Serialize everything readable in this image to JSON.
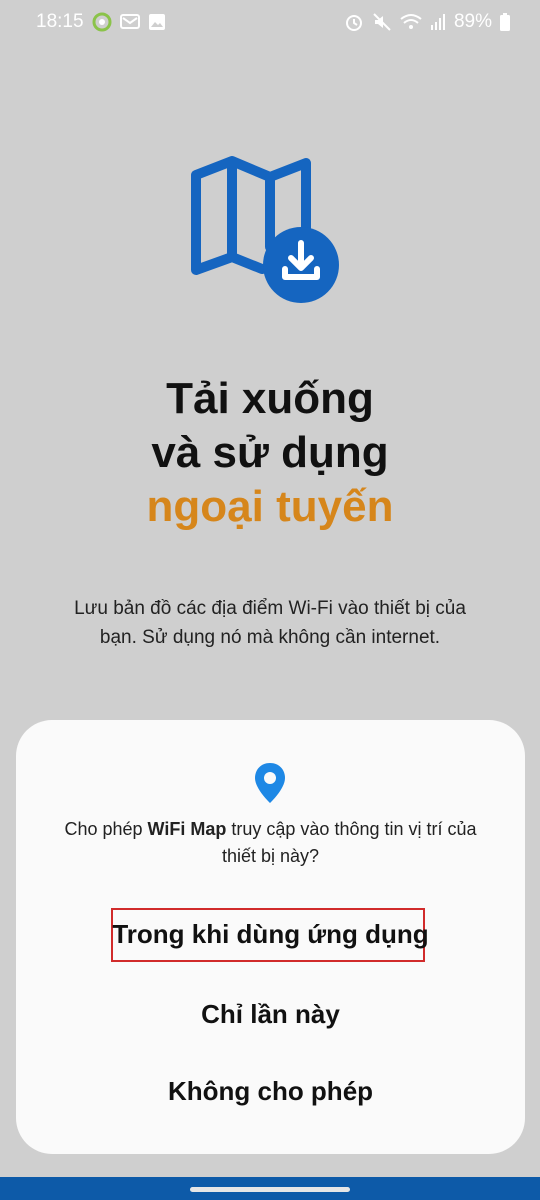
{
  "status_bar": {
    "time": "18:15",
    "battery": "89%",
    "left_icons": [
      "app-notification-icon",
      "messages-icon",
      "gallery-icon"
    ],
    "right_icons": [
      "alarm-icon",
      "mute-icon",
      "wifi-icon",
      "signal-icon",
      "battery-icon"
    ]
  },
  "hero": {
    "icon": "map-download-icon",
    "icon_color": "#1565c0"
  },
  "headline": {
    "line1": "Tải xuống",
    "line2": "và sử dụng",
    "line3": "ngoại tuyến",
    "accent_color": "#d6861b"
  },
  "subtitle": "Lưu bản đồ các địa điểm Wi-Fi vào thiết bị của bạn. Sử dụng nó mà không cần internet.",
  "dialog": {
    "icon": "location-pin-icon",
    "icon_color": "#1e88e5",
    "question_prefix": "Cho phép ",
    "app_name": "WiFi Map",
    "question_suffix": " truy cập vào thông tin vị trí của thiết bị này?",
    "options": [
      {
        "label": "Trong khi dùng ứng dụng"
      },
      {
        "label": "Chỉ lần này"
      },
      {
        "label": "Không cho phép"
      }
    ],
    "highlight_color": "#d12b2b"
  },
  "bottom_bar_color": "#0d5aa8"
}
